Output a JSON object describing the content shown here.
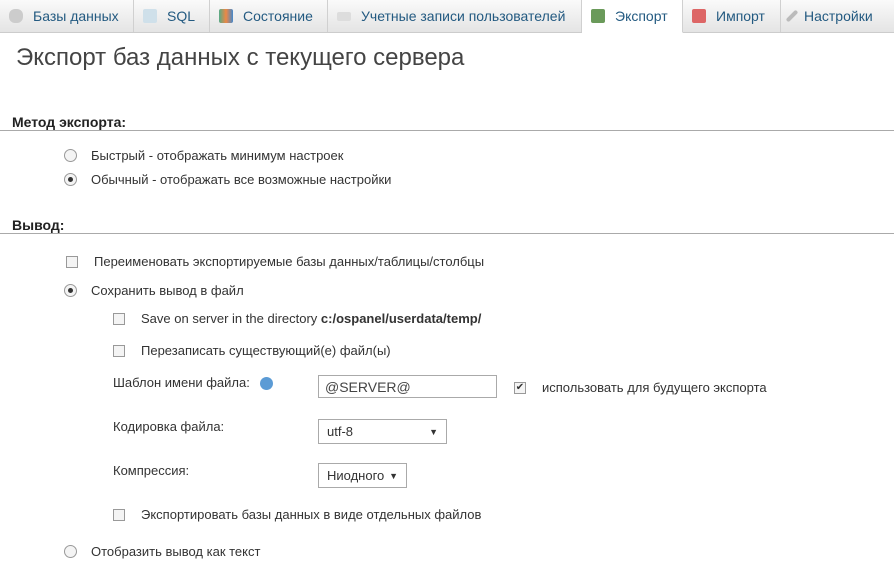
{
  "tabs": [
    {
      "label": "Базы данных",
      "icon": "database-icon"
    },
    {
      "label": "SQL",
      "icon": "sql-icon"
    },
    {
      "label": "Состояние",
      "icon": "status-icon"
    },
    {
      "label": "Учетные записи пользователей",
      "icon": "users-icon"
    },
    {
      "label": "Экспорт",
      "icon": "export-icon",
      "active": true
    },
    {
      "label": "Импорт",
      "icon": "import-icon"
    },
    {
      "label": "Настройки",
      "icon": "settings-icon"
    }
  ],
  "title": "Экспорт баз данных с текущего сервера",
  "method": {
    "heading": "Метод экспорта:",
    "quick": "Быстрый - отображать минимум настроек",
    "custom": "Обычный - отображать все возможные настройки",
    "selected": "custom"
  },
  "output": {
    "heading": "Вывод:",
    "rename": "Переименовать экспортируемые базы данных/таблицы/столбцы",
    "save_file": "Сохранить вывод в файл",
    "save_server": "Save on server in the directory ",
    "save_server_path": "c:/ospanel/userdata/temp/",
    "overwrite": "Перезаписать существующий(е) файл(ы)",
    "template_label": "Шаблон имени файла:",
    "template_value": "@SERVER@",
    "remember": "использовать для будущего экспорта",
    "charset_label": "Кодировка файла:",
    "charset_value": "utf-8",
    "compression_label": "Компрессия:",
    "compression_value": "Ниодного",
    "separate": "Экспортировать базы данных в виде отдельных файлов",
    "as_text": "Отобразить вывод как текст"
  }
}
